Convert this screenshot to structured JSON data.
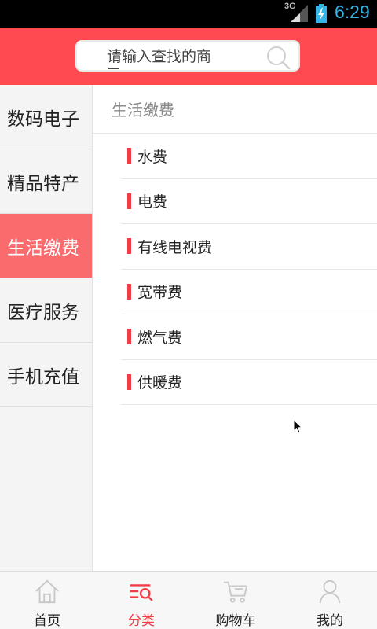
{
  "status_bar": {
    "network": "3G",
    "time": "6:29"
  },
  "search": {
    "placeholder": "请输入查找的商"
  },
  "sidebar": {
    "items": [
      {
        "label": "数码电子",
        "active": false
      },
      {
        "label": "精品特产",
        "active": false
      },
      {
        "label": "生活缴费",
        "active": true
      },
      {
        "label": "医疗服务",
        "active": false
      },
      {
        "label": "手机充值",
        "active": false
      }
    ]
  },
  "content": {
    "section_title": "生活缴费",
    "items": [
      {
        "label": "水费"
      },
      {
        "label": "电费"
      },
      {
        "label": "有线电视费"
      },
      {
        "label": "宽带费"
      },
      {
        "label": "燃气费"
      },
      {
        "label": "供暖费"
      }
    ]
  },
  "bottom_nav": {
    "items": [
      {
        "label": "首页",
        "icon": "home-icon",
        "active": false
      },
      {
        "label": "分类",
        "icon": "category-icon",
        "active": true
      },
      {
        "label": "购物车",
        "icon": "cart-icon",
        "active": false
      },
      {
        "label": "我的",
        "icon": "user-icon",
        "active": false
      }
    ]
  },
  "colors": {
    "accent": "#fe4a50",
    "active_category": "#fa6b6e",
    "marker": "#f23c46",
    "time": "#33b5e5"
  }
}
